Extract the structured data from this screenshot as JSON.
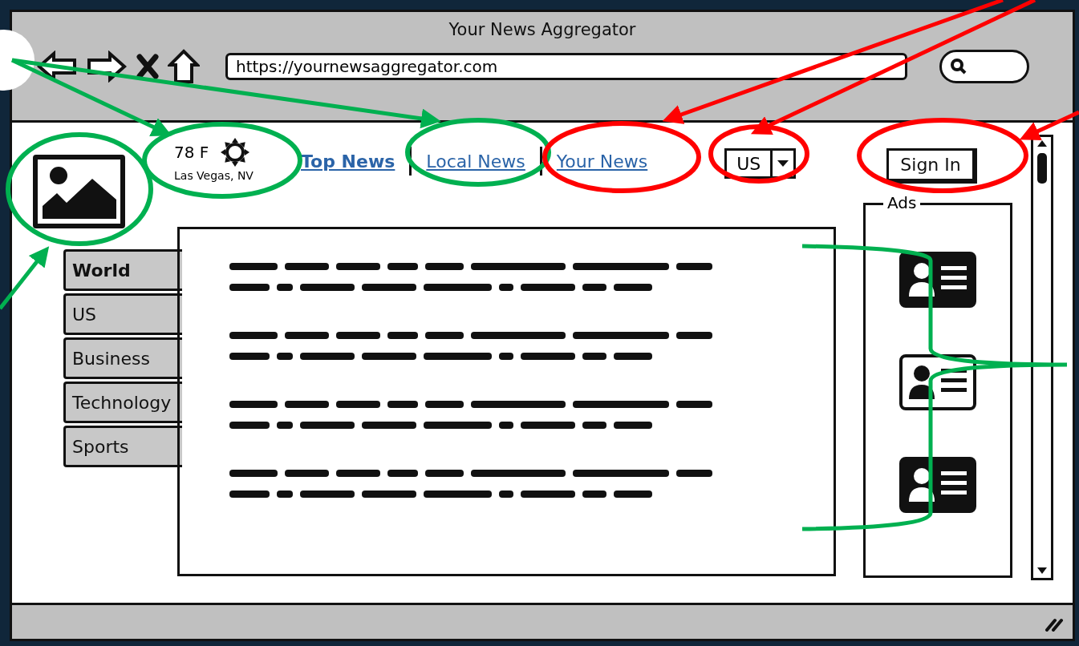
{
  "window": {
    "title": "Your News Aggregator",
    "url": "https://yournewsaggregator.com"
  },
  "weather": {
    "temperature": "78 F",
    "location": "Las Vegas, NV"
  },
  "nav_links": [
    {
      "label": "Top News",
      "selected": true
    },
    {
      "label": "Local News",
      "selected": false
    },
    {
      "label": "Your News",
      "selected": false
    }
  ],
  "region_dropdown": {
    "value": "US"
  },
  "sign_in": {
    "label": "Sign In"
  },
  "categories": [
    {
      "label": "World",
      "selected": true
    },
    {
      "label": "US",
      "selected": false
    },
    {
      "label": "Business",
      "selected": false
    },
    {
      "label": "Technology",
      "selected": false
    },
    {
      "label": "Sports",
      "selected": false
    }
  ],
  "articles": [
    {
      "kind": "greeked"
    },
    {
      "kind": "greeked"
    },
    {
      "kind": "greeked"
    },
    {
      "kind": "greeked"
    }
  ],
  "ads": {
    "title": "Ads",
    "items": [
      {
        "kind": "filled"
      },
      {
        "kind": "outlined"
      },
      {
        "kind": "filled"
      }
    ]
  },
  "annotations": {
    "highlights": [
      {
        "color": "#00b050"
      },
      {
        "color": "#00b050"
      },
      {
        "color": "#00b050"
      },
      {
        "color": "#ff0000"
      },
      {
        "color": "#ff0000"
      },
      {
        "color": "#ff0000"
      }
    ],
    "arrows": [
      {
        "color": "#00b050"
      },
      {
        "color": "#00b050"
      },
      {
        "color": "#00b050"
      },
      {
        "color": "#ff0000"
      },
      {
        "color": "#ff0000"
      },
      {
        "color": "#ff0000"
      }
    ],
    "brackets": [
      {
        "color": "#00b050"
      }
    ]
  }
}
